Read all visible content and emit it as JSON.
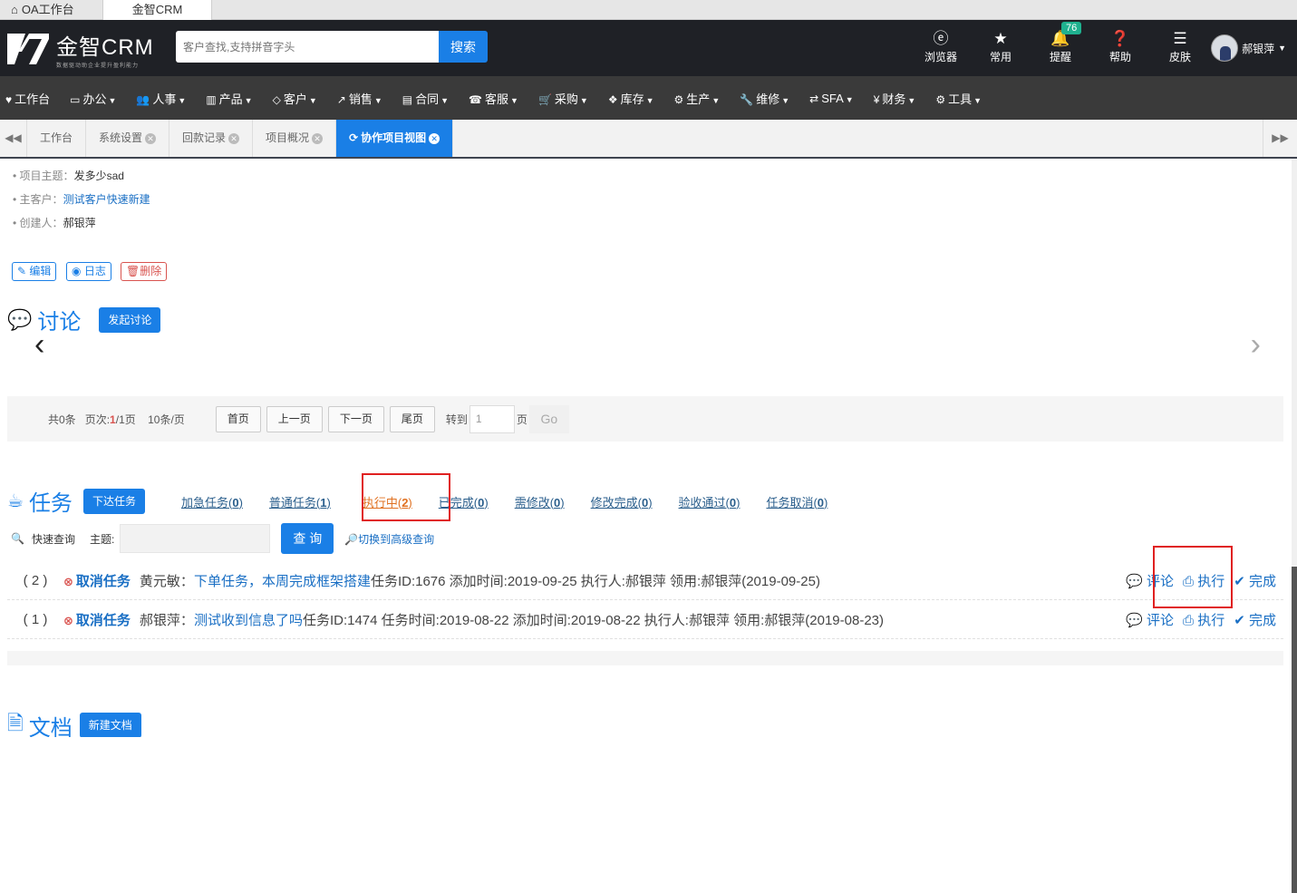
{
  "browser_tabs": [
    {
      "label": "OA工作台"
    },
    {
      "label": "金智CRM"
    }
  ],
  "app": {
    "logo_name": "金智CRM",
    "logo_tagline": "数据驱动助企业提升盈利能力",
    "search_placeholder": "客户查找,支持拼音字头",
    "search_button": "搜索",
    "user_name": "郝银萍"
  },
  "top_icons": [
    {
      "label": "浏览器",
      "icon": "ie-icon"
    },
    {
      "label": "常用",
      "icon": "star-icon"
    },
    {
      "label": "提醒",
      "icon": "bell-icon",
      "badge": "76"
    },
    {
      "label": "帮助",
      "icon": "help-icon"
    },
    {
      "label": "皮肤",
      "icon": "skin-icon"
    }
  ],
  "menu": [
    {
      "label": "工作台",
      "icon": "♥"
    },
    {
      "label": "办公",
      "icon": "▭"
    },
    {
      "label": "人事",
      "icon": "👥"
    },
    {
      "label": "产品",
      "icon": "▥"
    },
    {
      "label": "客户",
      "icon": "◇"
    },
    {
      "label": "销售",
      "icon": "↗"
    },
    {
      "label": "合同",
      "icon": "▤"
    },
    {
      "label": "客服",
      "icon": "☎"
    },
    {
      "label": "采购",
      "icon": "🛒"
    },
    {
      "label": "库存",
      "icon": "❖"
    },
    {
      "label": "生产",
      "icon": "⚙"
    },
    {
      "label": "维修",
      "icon": "🔧"
    },
    {
      "label": "SFA",
      "icon": "⇄"
    },
    {
      "label": "财务",
      "icon": "¥"
    },
    {
      "label": "工具",
      "icon": "⚙"
    }
  ],
  "page_tabs": [
    {
      "label": "工作台"
    },
    {
      "label": "系统设置"
    },
    {
      "label": "回款记录"
    },
    {
      "label": "项目概况"
    },
    {
      "label": "协作项目视图"
    }
  ],
  "project": {
    "subject_label": "项目主题：",
    "subject_value": "发多少sad",
    "customer_label": "主客户：",
    "customer_value": "测试客户快速新建",
    "creator_label": "创建人：",
    "creator_value": "郝银萍",
    "edit": "编辑",
    "log": "日志",
    "delete": "删除"
  },
  "discussion": {
    "title": "讨论",
    "new_button": "发起讨论"
  },
  "pager": {
    "total": "共0条",
    "page_prefix": "页次:",
    "page_current": "1",
    "page_total": "/1页",
    "per_page": "10条/页",
    "first": "首页",
    "prev": "上一页",
    "next": "下一页",
    "last": "尾页",
    "goto": "转到",
    "goto_value": "1",
    "page_unit": "页",
    "go": "Go"
  },
  "tasks": {
    "title": "任务",
    "new_button": "下达任务",
    "tabs": [
      {
        "label": "加急任务(",
        "count": "0",
        "end": ")"
      },
      {
        "label": "普通任务(",
        "count": "1",
        "end": ")"
      },
      {
        "label": "执行中(",
        "count": "2",
        "end": ")"
      },
      {
        "label": "已完成(",
        "count": "0",
        "end": ")"
      },
      {
        "label": "需修改(",
        "count": "0",
        "end": ")"
      },
      {
        "label": "修改完成(",
        "count": "0",
        "end": ")"
      },
      {
        "label": "验收通过(",
        "count": "0",
        "end": ")"
      },
      {
        "label": "任务取消(",
        "count": "0",
        "end": ")"
      }
    ],
    "quick_search": "快速查询",
    "subject_label": "主题:",
    "query_button": "查 询",
    "advanced": "切换到高级查询",
    "rows": [
      {
        "num": "( 2 )",
        "cancel": "取消任务",
        "owner": "黄元敏：",
        "title": "下单任务，本周完成框架搭建",
        "meta": " 任务ID:1676 添加时间:2019-09-25 执行人:郝银萍 领用:郝银萍(2019-09-25)"
      },
      {
        "num": "( 1 )",
        "cancel": "取消任务",
        "owner": "郝银萍：",
        "title": "测试收到信息了吗",
        "meta": " 任务ID:1474 任务时间:2019-08-22 添加时间:2019-08-22 执行人:郝银萍 领用:郝银萍(2019-08-23)"
      }
    ],
    "comment": "评论",
    "execute": "执行",
    "done": "完成"
  },
  "docs": {
    "title": "文档",
    "new_button": "新建文档"
  }
}
